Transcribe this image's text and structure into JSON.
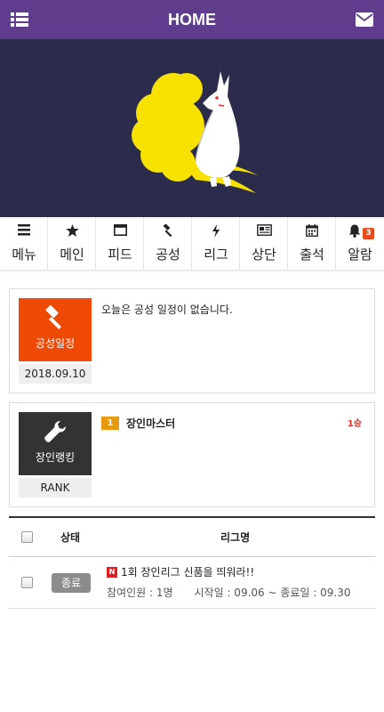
{
  "header": {
    "title": "HOME",
    "left_icon": "list-menu-icon",
    "right_icon": "envelope-icon",
    "bg_color": "#5f3d8c"
  },
  "banner": {
    "image": "yellow-nine-tailed-fox-logo",
    "bg_color": "#2b2c4c"
  },
  "tabs": [
    {
      "label": "메뉴",
      "icon": "bars-icon"
    },
    {
      "label": "메인",
      "icon": "star-icon"
    },
    {
      "label": "피드",
      "icon": "window-icon"
    },
    {
      "label": "공성",
      "icon": "gavel-icon"
    },
    {
      "label": "리그",
      "icon": "bolt-icon"
    },
    {
      "label": "상단",
      "icon": "newspaper-icon"
    },
    {
      "label": "출석",
      "icon": "calendar-icon"
    },
    {
      "label": "알람",
      "icon": "bell-icon",
      "badge": "3"
    }
  ],
  "siege_card": {
    "tile_label": "공성일정",
    "tile_color": "#ef4a05",
    "date": "2018.09.10",
    "message": "오늘은 공성 일정이 없습니다."
  },
  "ranking_card": {
    "tile_label": "장인랭킹",
    "tile_color": "#333333",
    "footer": "RANK",
    "entries": [
      {
        "rank": "1",
        "name": "장인마스터",
        "wins": "1승"
      }
    ]
  },
  "league_table": {
    "headers": {
      "status": "상태",
      "name": "리그명"
    },
    "rows": [
      {
        "status": "종료",
        "new_badge": "N",
        "title": "1회 장인리그 신품을 띄워라!!",
        "participants": "참여인원 : 1명",
        "period": "시작일 : 09.06 ~ 종료일 : 09.30"
      }
    ]
  }
}
